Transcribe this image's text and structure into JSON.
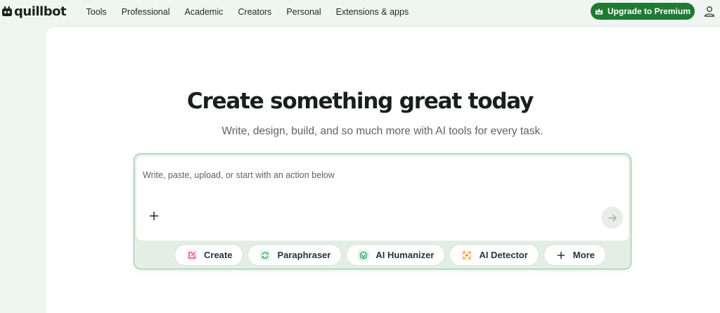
{
  "header": {
    "logo_text": "quillbot",
    "nav": [
      "Tools",
      "Professional",
      "Academic",
      "Creators",
      "Personal",
      "Extensions & apps"
    ],
    "upgrade_label": "Upgrade to Premium"
  },
  "hero": {
    "title": "Create something great today",
    "subtitle": "Write, design, build, and so much more with AI tools for every task."
  },
  "composer": {
    "input_placeholder": "Write, paste, upload, or start with an action below",
    "input_value": "",
    "chips": [
      {
        "label": "Create",
        "icon": "pencil-square-icon",
        "color": "#d63384"
      },
      {
        "label": "Paraphraser",
        "icon": "refresh-icon",
        "color": "#3cab5a"
      },
      {
        "label": "AI Humanizer",
        "icon": "humanizer-icon",
        "color": "#2e9e60"
      },
      {
        "label": "AI Detector",
        "icon": "scan-icon",
        "color": "#ef8a1f"
      },
      {
        "label": "More",
        "icon": "plus-icon",
        "color": "#2a3430"
      }
    ]
  },
  "colors": {
    "brand_green": "#1f7a33",
    "page_background": "#eff5f0",
    "composer_border": "#8ec59a"
  }
}
